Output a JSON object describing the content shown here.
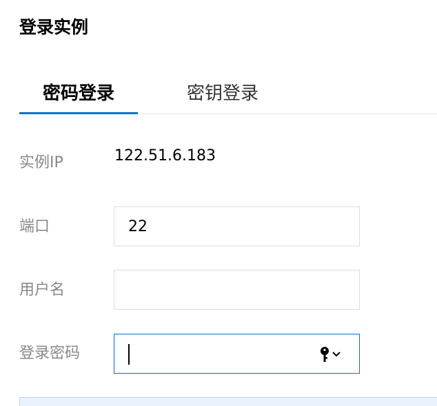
{
  "title": "登录实例",
  "tabs": [
    {
      "label": "密码登录",
      "active": true
    },
    {
      "label": "密钥登录",
      "active": false
    }
  ],
  "form": {
    "instance_ip": {
      "label": "实例IP",
      "value": "122.51.6.183"
    },
    "port": {
      "label": "端口",
      "value": "22"
    },
    "username": {
      "label": "用户名",
      "value": ""
    },
    "password": {
      "label": "登录密码",
      "value": ""
    }
  },
  "icons": {
    "password_manager": "key-icon",
    "dropdown": "chevron-down-icon"
  },
  "colors": {
    "accent": "#0070cc",
    "label": "#888888",
    "border": "#dcdcdc"
  }
}
